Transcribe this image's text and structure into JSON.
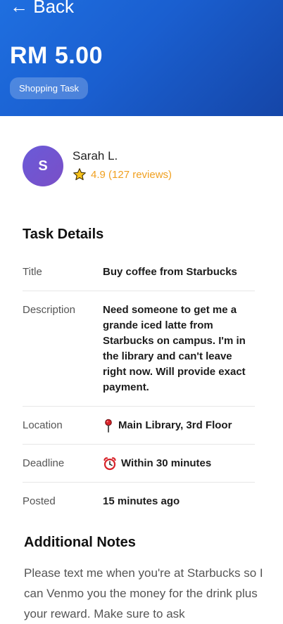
{
  "header": {
    "back_label": "← Back",
    "price": "RM 5.00",
    "category": "Shopping Task"
  },
  "poster": {
    "initial": "S",
    "name": "Sarah L.",
    "rating": "4.9 (127 reviews)"
  },
  "task_details": {
    "title": "Task Details",
    "rows": [
      {
        "label": "Title",
        "value": "Buy coffee from Starbucks"
      },
      {
        "label": "Description",
        "value": "Need someone to get me a grande iced latte from Starbucks on campus. I'm in the library and can't leave right now. Will provide exact payment."
      },
      {
        "label": "Location",
        "value": "Main Library, 3rd Floor",
        "icon": "pin-icon"
      },
      {
        "label": "Deadline",
        "value": "Within 30 minutes",
        "icon": "alarm-clock-icon"
      },
      {
        "label": "Posted",
        "value": "15 minutes ago"
      }
    ]
  },
  "notes": {
    "title": "Additional Notes",
    "text": "Please text me when you're at Starbucks so I can Venmo you the money for the drink plus your reward. Make sure to ask"
  },
  "colors": {
    "header_gradient_start": "#1f6fe0",
    "header_gradient_end": "#1546a8",
    "rating": "#f0a020",
    "avatar": "#6a5ad8"
  }
}
